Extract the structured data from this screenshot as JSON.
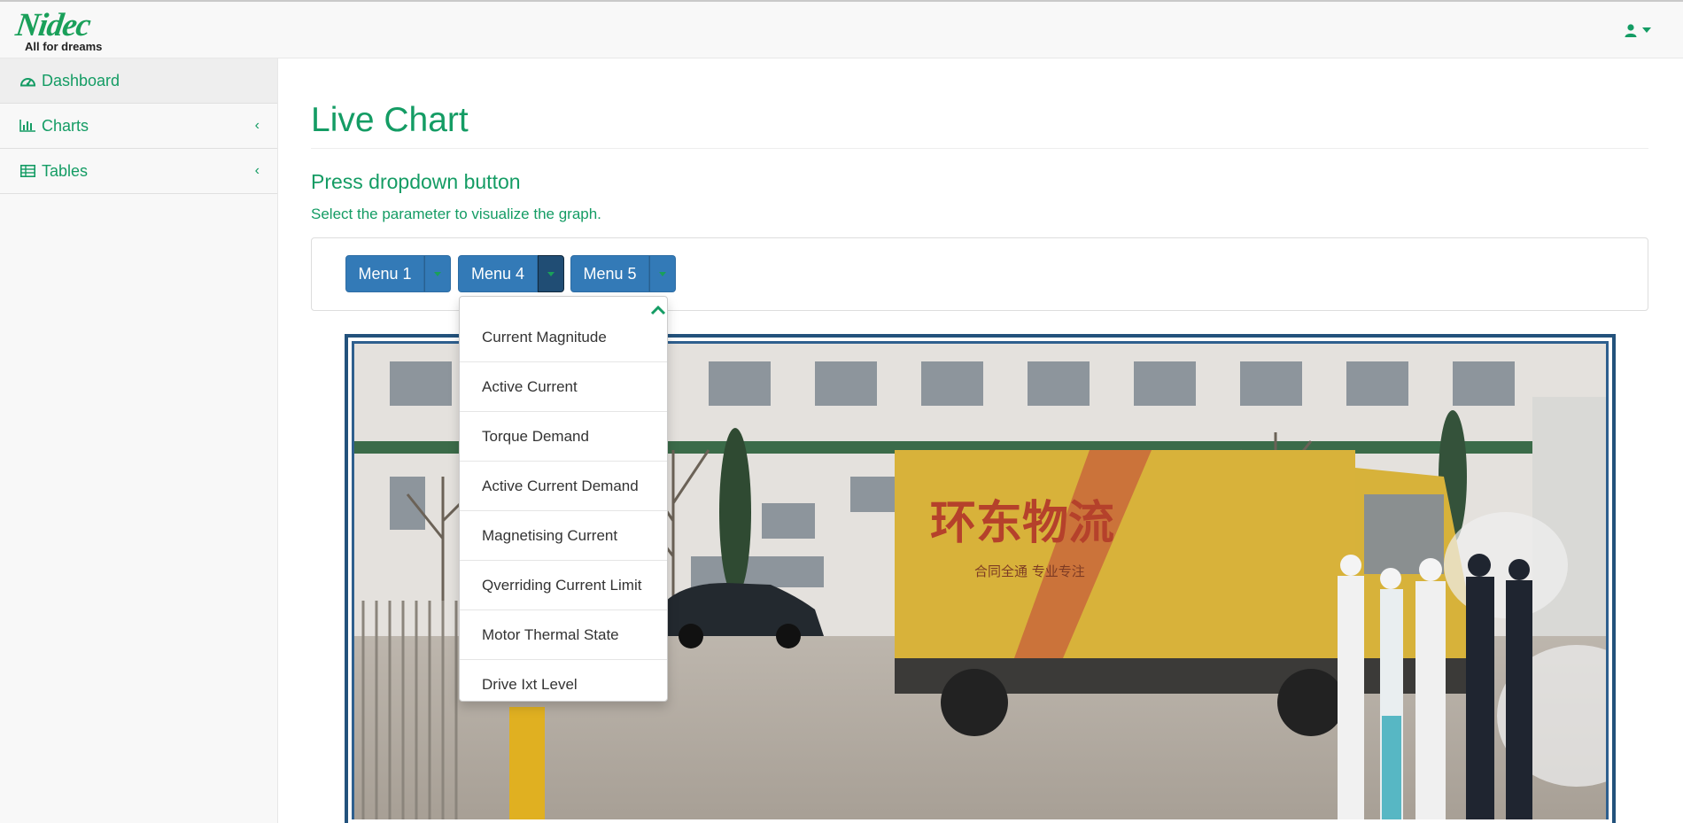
{
  "brand": {
    "logo_word": "Nidec",
    "logo_tagline": "All for dreams"
  },
  "navbar": {
    "user_icon": "user-icon"
  },
  "sidebar": {
    "items": [
      {
        "label": "Dashboard",
        "icon": "dashboard-icon"
      },
      {
        "label": "Charts",
        "icon": "bar-chart-icon"
      },
      {
        "label": "Tables",
        "icon": "table-icon"
      }
    ]
  },
  "main": {
    "title": "Live Chart",
    "subheading": "Press dropdown button",
    "helptext": "Select the parameter to visualize the graph."
  },
  "menus": [
    {
      "label": "Menu 1"
    },
    {
      "label": "Menu 4"
    },
    {
      "label": "Menu 5"
    }
  ],
  "dropdown": {
    "items": [
      "Current Magnitude",
      "Active Current",
      "Torque Demand",
      "Active Current Demand",
      "Magnetising Current",
      "Qverriding Current Limit",
      "Motor Thermal State",
      "Drive Ixt Level"
    ]
  },
  "photo": {
    "truck_sign": "环东物流",
    "truck_slogan": "合同全通 专业专注"
  },
  "colors": {
    "accent": "#149c64",
    "button": "#337ab7",
    "button_active": "#204d74",
    "frame": "#23527c"
  }
}
